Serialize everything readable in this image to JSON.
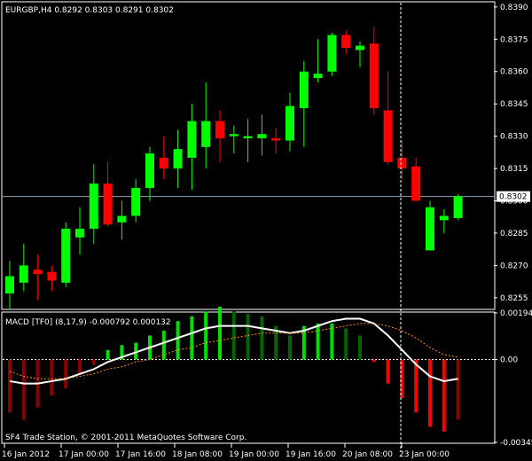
{
  "main_panel": {
    "header": "EURGBP,H4  0.8292 0.8303 0.8291 0.8302",
    "price_ticks": [
      "0.8390",
      "0.8375",
      "0.8360",
      "0.8345",
      "0.8330",
      "0.8315",
      "0.8300",
      "0.8285",
      "0.8270",
      "0.8255"
    ],
    "current_price_label": "0.8302"
  },
  "macd_panel": {
    "header": "MACD [TF0] (8,17,9)  -0.000792 0.000132",
    "ticks": [
      "0.00194",
      "0.00",
      "-0.00345"
    ],
    "footer": "SF4 Trade Station, © 2001-2011 MetaQuotes Software Corp."
  },
  "time_axis": {
    "labels": [
      "16 Jan 2012",
      "17 Jan 00:00",
      "17 Jan 16:00",
      "18 Jan 08:00",
      "19 Jan 00:00",
      "19 Jan 16:00",
      "20 Jan 08:00",
      "23 Jan 00:00"
    ]
  },
  "colors": {
    "background": "#000000",
    "bull": "#00ff00",
    "bear": "#ff0000",
    "macd_line": "#ffffff",
    "signal_line": "#ff8c1a",
    "grid": "#ffffff"
  },
  "chart_data": [
    {
      "type": "candlestick",
      "title": "EURGBP,H4",
      "ylim": [
        0.825,
        0.8392
      ],
      "current_price": 0.8302,
      "candles": [
        {
          "o": 0.8257,
          "h": 0.8272,
          "l": 0.825,
          "c": 0.8265
        },
        {
          "o": 0.8262,
          "h": 0.828,
          "l": 0.8258,
          "c": 0.827
        },
        {
          "o": 0.8268,
          "h": 0.8275,
          "l": 0.8254,
          "c": 0.8266
        },
        {
          "o": 0.8267,
          "h": 0.827,
          "l": 0.8258,
          "c": 0.8263
        },
        {
          "o": 0.8262,
          "h": 0.829,
          "l": 0.826,
          "c": 0.8287
        },
        {
          "o": 0.8283,
          "h": 0.8297,
          "l": 0.8275,
          "c": 0.8287
        },
        {
          "o": 0.8287,
          "h": 0.8317,
          "l": 0.828,
          "c": 0.8308
        },
        {
          "o": 0.8308,
          "h": 0.8318,
          "l": 0.8288,
          "c": 0.8289
        },
        {
          "o": 0.829,
          "h": 0.83,
          "l": 0.8282,
          "c": 0.8293
        },
        {
          "o": 0.8293,
          "h": 0.831,
          "l": 0.829,
          "c": 0.8306
        },
        {
          "o": 0.8306,
          "h": 0.8325,
          "l": 0.83,
          "c": 0.8322
        },
        {
          "o": 0.832,
          "h": 0.833,
          "l": 0.831,
          "c": 0.8315
        },
        {
          "o": 0.8315,
          "h": 0.8333,
          "l": 0.8306,
          "c": 0.8324
        },
        {
          "o": 0.832,
          "h": 0.8345,
          "l": 0.8305,
          "c": 0.8337
        },
        {
          "o": 0.8325,
          "h": 0.8355,
          "l": 0.8315,
          "c": 0.8337
        },
        {
          "o": 0.8337,
          "h": 0.8342,
          "l": 0.8318,
          "c": 0.8329
        },
        {
          "o": 0.833,
          "h": 0.8335,
          "l": 0.8322,
          "c": 0.8331
        },
        {
          "o": 0.8329,
          "h": 0.8338,
          "l": 0.8318,
          "c": 0.833
        },
        {
          "o": 0.8329,
          "h": 0.834,
          "l": 0.8321,
          "c": 0.8331
        },
        {
          "o": 0.8329,
          "h": 0.8334,
          "l": 0.8322,
          "c": 0.8328
        },
        {
          "o": 0.8328,
          "h": 0.835,
          "l": 0.8323,
          "c": 0.8344
        },
        {
          "o": 0.8343,
          "h": 0.8365,
          "l": 0.8325,
          "c": 0.836
        },
        {
          "o": 0.8357,
          "h": 0.8375,
          "l": 0.8355,
          "c": 0.8359
        },
        {
          "o": 0.836,
          "h": 0.8378,
          "l": 0.8358,
          "c": 0.8377
        },
        {
          "o": 0.8377,
          "h": 0.8379,
          "l": 0.8368,
          "c": 0.8371
        },
        {
          "o": 0.837,
          "h": 0.8374,
          "l": 0.8362,
          "c": 0.8372
        },
        {
          "o": 0.8373,
          "h": 0.8381,
          "l": 0.834,
          "c": 0.8343
        },
        {
          "o": 0.8342,
          "h": 0.836,
          "l": 0.8317,
          "c": 0.8318
        },
        {
          "o": 0.832,
          "h": 0.8328,
          "l": 0.831,
          "c": 0.8315
        },
        {
          "o": 0.8316,
          "h": 0.832,
          "l": 0.83,
          "c": 0.83
        },
        {
          "o": 0.8277,
          "h": 0.83,
          "l": 0.8277,
          "c": 0.8297
        },
        {
          "o": 0.8291,
          "h": 0.8296,
          "l": 0.8285,
          "c": 0.8293
        },
        {
          "o": 0.8292,
          "h": 0.8303,
          "l": 0.8291,
          "c": 0.8302
        }
      ]
    },
    {
      "type": "bar",
      "title": "MACD [TF0] (8,17,9)",
      "ylim": [
        -0.00345,
        0.00194
      ],
      "histogram": [
        -0.0022,
        -0.0025,
        -0.002,
        -0.0015,
        -0.0012,
        -0.0006,
        -0.0002,
        0.0004,
        0.0006,
        0.0007,
        0.001,
        0.0012,
        0.0016,
        0.0018,
        0.002,
        0.0022,
        0.002,
        0.0019,
        0.0018,
        0.0014,
        0.001,
        0.0014,
        0.0015,
        0.0015,
        0.0013,
        0.001,
        -0.0001,
        -0.001,
        -0.0016,
        -0.0022,
        -0.0028,
        -0.003,
        -0.0025
      ],
      "histogram_rising": [
        false,
        false,
        true,
        true,
        true,
        true,
        true,
        true,
        true,
        true,
        true,
        true,
        true,
        true,
        true,
        true,
        false,
        false,
        false,
        false,
        false,
        true,
        true,
        true,
        false,
        false,
        false,
        false,
        false,
        false,
        false,
        false,
        true
      ],
      "series": [
        {
          "values": [
            -0.0009,
            -0.001,
            -0.001,
            -0.0009,
            -0.0008,
            -0.0006,
            -0.0004,
            -0.0001,
            0.0001,
            0.0003,
            0.0005,
            0.0007,
            0.0009,
            0.0011,
            0.0013,
            0.0014,
            0.0014,
            0.0014,
            0.0013,
            0.0012,
            0.0011,
            0.0012,
            0.0014,
            0.0016,
            0.0017,
            0.0017,
            0.0015,
            0.001,
            0.0004,
            -0.0002,
            -0.0007,
            -0.0009,
            -0.0008
          ]
        },
        {
          "values": [
            -0.0005,
            -0.0007,
            -0.0008,
            -0.0008,
            -0.0008,
            -0.0007,
            -0.0006,
            -0.0004,
            -0.0003,
            -0.0001,
            0.0,
            0.0002,
            0.0004,
            0.0005,
            0.0007,
            0.0008,
            0.0009,
            0.001,
            0.0011,
            0.0011,
            0.0011,
            0.0011,
            0.0012,
            0.0013,
            0.0014,
            0.0015,
            0.0015,
            0.0014,
            0.0012,
            0.0009,
            0.0005,
            0.0002,
            0.0001
          ]
        }
      ]
    }
  ]
}
